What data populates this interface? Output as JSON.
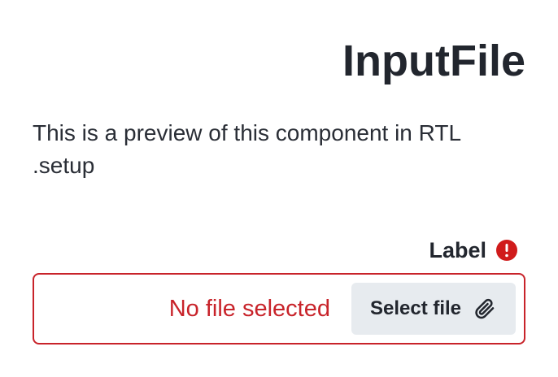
{
  "page": {
    "title": "InputFile",
    "description_line1": "This is a preview of this component in RTL",
    "description_line2": ".setup"
  },
  "field": {
    "label": "Label",
    "error_icon": "error-circle-icon",
    "status_text": "No file selected",
    "button_label": "Select file",
    "button_icon": "paperclip-icon"
  },
  "colors": {
    "error": "#c8232a",
    "button_background": "#e7ebef",
    "text": "#22262e"
  }
}
